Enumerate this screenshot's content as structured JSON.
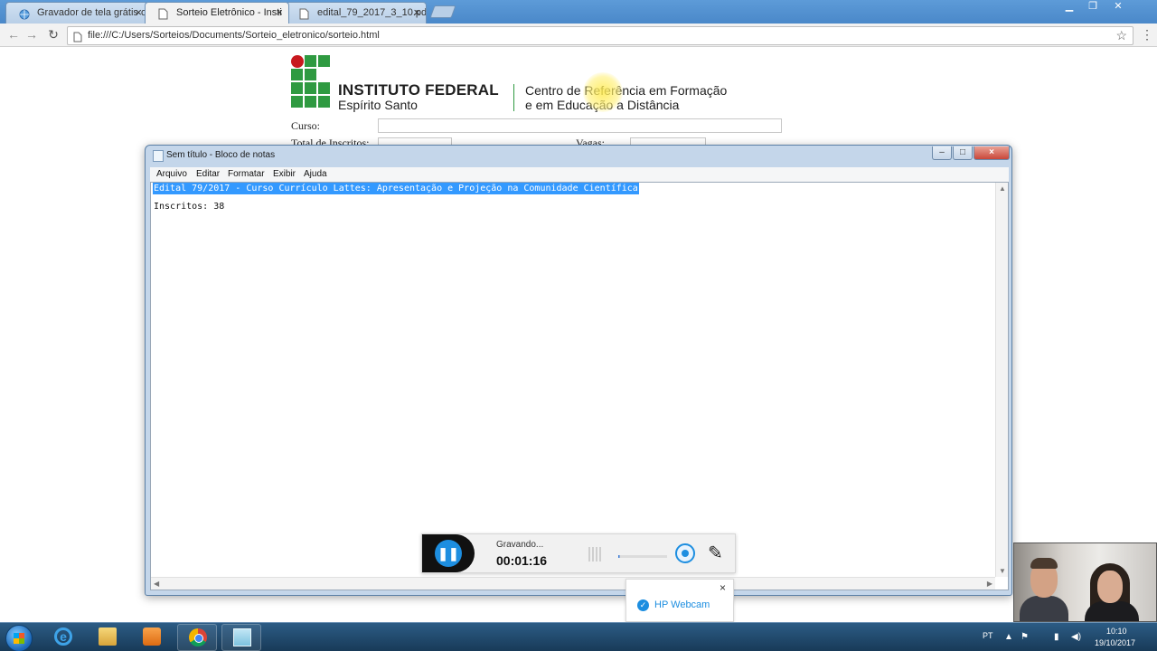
{
  "browser": {
    "tabs": [
      {
        "label": "Gravador de tela grátis o",
        "close": "×"
      },
      {
        "label": "Sorteio Eletrônico - Insti",
        "close": "×"
      },
      {
        "label": "edital_79_2017_3_10.pdf",
        "close": "×"
      }
    ],
    "url": "file:///C:/Users/Sorteios/Documents/Sorteio_eletronico/sorteio.html",
    "window_buttons": {
      "minimize": "▁",
      "restore": "❐",
      "close": "✕"
    }
  },
  "page": {
    "brand_title": "INSTITUTO FEDERAL",
    "brand_subtitle": "Espírito Santo",
    "centro_line1": "Centro de Referência em Formação",
    "centro_line2": "e em Educação a Distância",
    "logo_colors": {
      "green": "#2f9a41",
      "red": "#c8191e"
    },
    "form": {
      "curso_label": "Curso:",
      "curso_value": "",
      "total_label": "Total de Inscritos:",
      "vagas_label": "Vagas:"
    }
  },
  "notepad": {
    "title": "Sem título - Bloco de notas",
    "menu": [
      "Arquivo",
      "Editar",
      "Formatar",
      "Exibir",
      "Ajuda"
    ],
    "line1": "Edital 79/2017 - Curso Currículo Lattes: Apresentação e Projeção na Comunidade Científica",
    "line2": "Inscritos: 38",
    "selection_color": "#3399ff"
  },
  "recorder": {
    "status": "Gravando...",
    "time": "00:01:16",
    "pause_icon": "pause-icon",
    "webcam_icon": "webcam-icon",
    "pen_icon": "pencil-icon",
    "popup_label": "HP Webcam",
    "popup_close": "×"
  },
  "taskbar": {
    "apps": [
      "start-button",
      "internet-explorer",
      "file-explorer",
      "media-player",
      "google-chrome",
      "notepad"
    ],
    "language": "PT",
    "time": "10:10",
    "date": "19/10/2017"
  }
}
